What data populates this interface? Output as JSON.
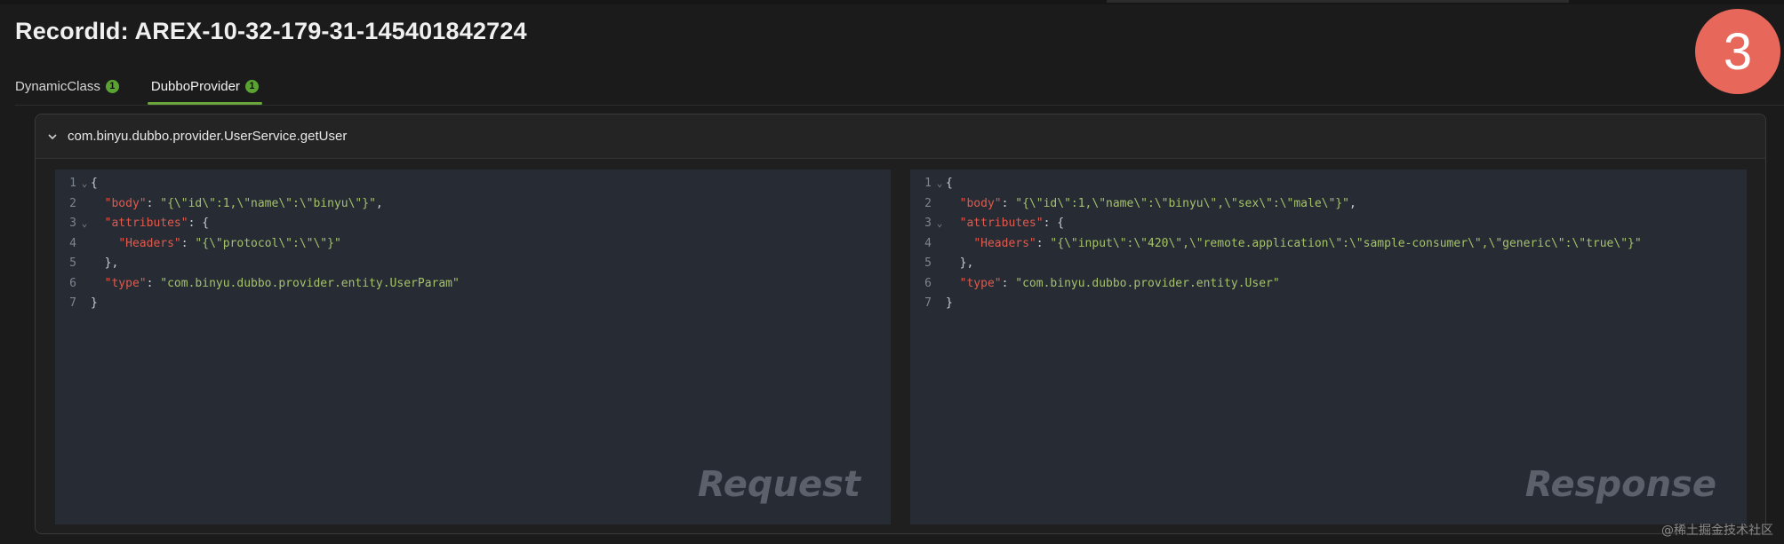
{
  "record": {
    "title": "RecordId: AREX-10-32-179-31-145401842724"
  },
  "step_badge": "3",
  "tabs": [
    {
      "label": "DynamicClass",
      "count": "1",
      "active": false
    },
    {
      "label": "DubboProvider",
      "count": "1",
      "active": true
    }
  ],
  "panel": {
    "method": "com.binyu.dubbo.provider.UserService.getUser",
    "chevron_icon": "chevron-down-icon"
  },
  "request": {
    "watermark": "Request",
    "lines": [
      {
        "n": "1",
        "fold": "⌄",
        "parts": [
          [
            "p",
            "{"
          ]
        ]
      },
      {
        "n": "2",
        "fold": "",
        "parts": [
          [
            "p",
            "  "
          ],
          [
            "k",
            "\"body\""
          ],
          [
            "p",
            ": "
          ],
          [
            "s",
            "\"{\\\"id\\\":1,\\\"name\\\":\\\"binyu\\\"}\""
          ],
          [
            "p",
            ","
          ]
        ]
      },
      {
        "n": "3",
        "fold": "⌄",
        "parts": [
          [
            "p",
            "  "
          ],
          [
            "k",
            "\"attributes\""
          ],
          [
            "p",
            ": {"
          ]
        ]
      },
      {
        "n": "4",
        "fold": "",
        "parts": [
          [
            "p",
            "    "
          ],
          [
            "k",
            "\"Headers\""
          ],
          [
            "p",
            ": "
          ],
          [
            "s",
            "\"{\\\"protocol\\\":\\\"\\\"}\""
          ]
        ]
      },
      {
        "n": "5",
        "fold": "",
        "parts": [
          [
            "p",
            "  },"
          ]
        ]
      },
      {
        "n": "6",
        "fold": "",
        "parts": [
          [
            "p",
            "  "
          ],
          [
            "k",
            "\"type\""
          ],
          [
            "p",
            ": "
          ],
          [
            "s",
            "\"com.binyu.dubbo.provider.entity.UserParam\""
          ]
        ]
      },
      {
        "n": "7",
        "fold": "",
        "parts": [
          [
            "p",
            "}"
          ]
        ]
      }
    ]
  },
  "response": {
    "watermark": "Response",
    "lines": [
      {
        "n": "1",
        "fold": "⌄",
        "parts": [
          [
            "p",
            "{"
          ]
        ]
      },
      {
        "n": "2",
        "fold": "",
        "parts": [
          [
            "p",
            "  "
          ],
          [
            "k",
            "\"body\""
          ],
          [
            "p",
            ": "
          ],
          [
            "s",
            "\"{\\\"id\\\":1,\\\"name\\\":\\\"binyu\\\",\\\"sex\\\":\\\"male\\\"}\""
          ],
          [
            "p",
            ","
          ]
        ]
      },
      {
        "n": "3",
        "fold": "⌄",
        "parts": [
          [
            "p",
            "  "
          ],
          [
            "k",
            "\"attributes\""
          ],
          [
            "p",
            ": {"
          ]
        ]
      },
      {
        "n": "4",
        "fold": "",
        "parts": [
          [
            "p",
            "    "
          ],
          [
            "k",
            "\"Headers\""
          ],
          [
            "p",
            ": "
          ],
          [
            "s",
            "\"{\\\"input\\\":\\\"420\\\",\\\"remote.application\\\":\\\"sample-consumer\\\",\\\"generic\\\":\\\"true\\\"}\""
          ]
        ]
      },
      {
        "n": "5",
        "fold": "",
        "parts": [
          [
            "p",
            "  },"
          ]
        ]
      },
      {
        "n": "6",
        "fold": "",
        "parts": [
          [
            "p",
            "  "
          ],
          [
            "k",
            "\"type\""
          ],
          [
            "p",
            ": "
          ],
          [
            "s",
            "\"com.binyu.dubbo.provider.entity.User\""
          ]
        ]
      },
      {
        "n": "7",
        "fold": "",
        "parts": [
          [
            "p",
            "}"
          ]
        ]
      }
    ]
  },
  "credit": "@稀土掘金技术社区",
  "colors": {
    "background": "#1b1b1b",
    "accent_green": "#6aa63b",
    "badge_red": "#e8675b",
    "editor_bg": "#272b33",
    "json_key": "#e05a4e",
    "json_string": "#a5c26b"
  }
}
